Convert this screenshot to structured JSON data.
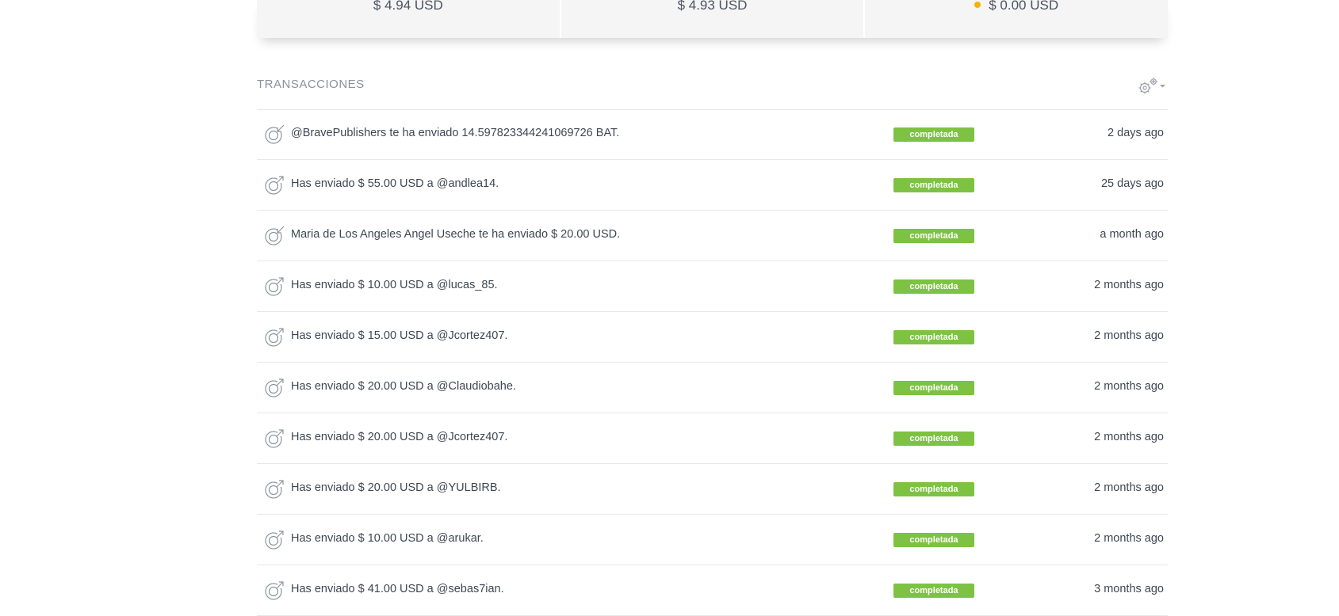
{
  "balances": [
    {
      "value": "$ 4.94 USD"
    },
    {
      "value": "$ 4.93 USD"
    },
    {
      "value": "$ 0.00 USD",
      "pending_color": "#f4b400"
    }
  ],
  "transactions": {
    "title": "TRANSACCIONES",
    "settings_icon": "gears-icon",
    "badge_color": "#7dc242",
    "rows": [
      {
        "direction": "incoming",
        "text": "@BravePublishers te ha enviado 14.597823344241069726 BAT.",
        "status": "completada",
        "time": "2 days ago"
      },
      {
        "direction": "outgoing",
        "text": "Has enviado $ 55.00 USD a @andlea14.",
        "status": "completada",
        "time": "25 days ago"
      },
      {
        "direction": "incoming",
        "text": "Maria de Los Angeles Angel Useche te ha enviado $ 20.00 USD.",
        "status": "completada",
        "time": "a month ago"
      },
      {
        "direction": "outgoing",
        "text": "Has enviado $ 10.00 USD a @lucas_85.",
        "status": "completada",
        "time": "2 months ago"
      },
      {
        "direction": "outgoing",
        "text": "Has enviado $ 15.00 USD a @Jcortez407.",
        "status": "completada",
        "time": "2 months ago"
      },
      {
        "direction": "outgoing",
        "text": "Has enviado $ 20.00 USD a @Claudiobahe.",
        "status": "completada",
        "time": "2 months ago"
      },
      {
        "direction": "outgoing",
        "text": "Has enviado $ 20.00 USD a @Jcortez407.",
        "status": "completada",
        "time": "2 months ago"
      },
      {
        "direction": "outgoing",
        "text": "Has enviado $ 20.00 USD a @YULBIRB.",
        "status": "completada",
        "time": "2 months ago"
      },
      {
        "direction": "outgoing",
        "text": "Has enviado $ 10.00 USD a @arukar.",
        "status": "completada",
        "time": "2 months ago"
      },
      {
        "direction": "outgoing",
        "text": "Has enviado $ 41.00 USD a @sebas7ian.",
        "status": "completada",
        "time": "3 months ago"
      }
    ]
  }
}
